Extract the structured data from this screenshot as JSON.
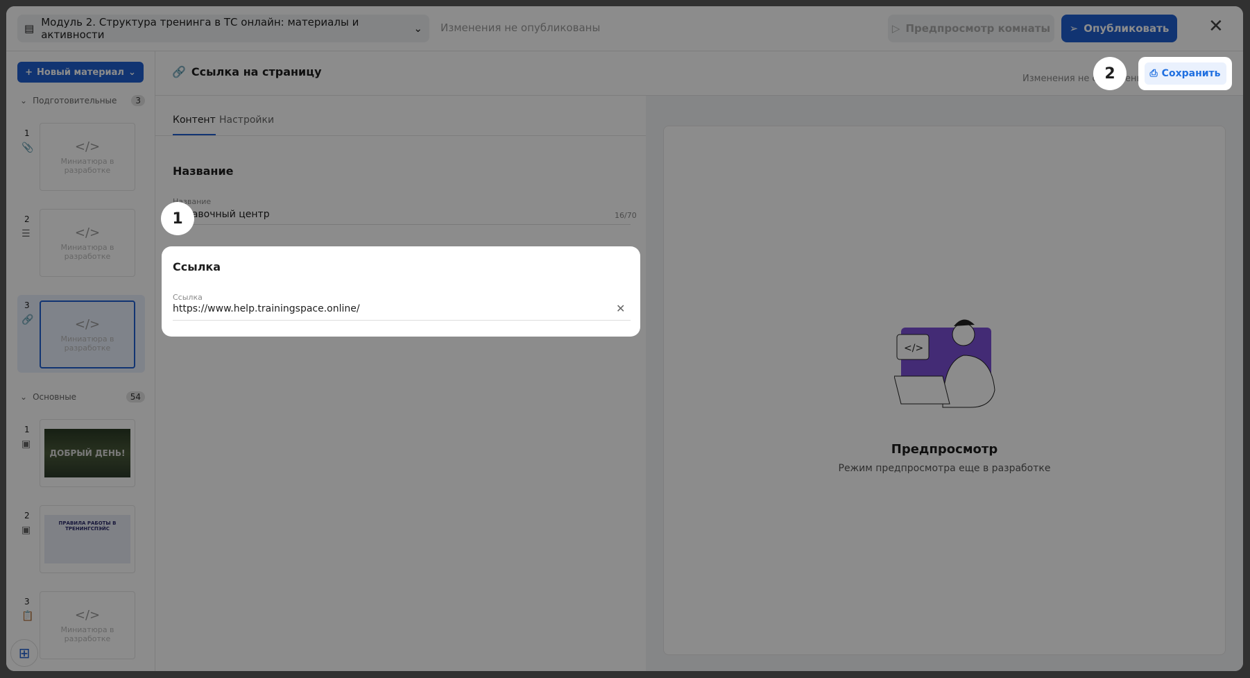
{
  "header": {
    "module_title": "Модуль 2. Структура тренинга в ТС онлайн: материалы и активности",
    "unpublished": "Изменения не опубликованы",
    "preview_room": "Предпросмотр комнаты",
    "publish": "Опубликовать"
  },
  "sidebar": {
    "new_material": "Новый материал",
    "sections": [
      {
        "title": "Подготовительные",
        "count": "3",
        "items": [
          {
            "num": "1",
            "icon": "paperclip-icon",
            "thumb": "Миниатюра в разработке"
          },
          {
            "num": "2",
            "icon": "checklist-icon",
            "thumb": "Миниатюра в разработке"
          },
          {
            "num": "3",
            "icon": "link-icon",
            "thumb": "Миниатюра в разработке"
          }
        ]
      },
      {
        "title": "Основные",
        "count": "54",
        "items": [
          {
            "num": "1",
            "icon": "presentation-icon",
            "thumb": "ДОБРЫЙ ДЕНЬ!"
          },
          {
            "num": "2",
            "icon": "presentation-icon",
            "thumb": "ПРАВИЛА РАБОТЫ В ТРЕНИНГСПЭЙС"
          },
          {
            "num": "3",
            "icon": "clipboard-icon",
            "thumb": "Миниатюра в разработке"
          }
        ]
      }
    ]
  },
  "editor": {
    "title": "Ссылка на страницу",
    "status": "Изменения не сохранены",
    "save": "Сохранить",
    "tabs": [
      "Контент",
      "Настройки"
    ],
    "name_section": "Название",
    "name_label": "Название",
    "name_value": "Справочный центр",
    "name_count": "16/70",
    "link_section": "Ссылка",
    "link_label": "Ссылка",
    "link_value": "https://www.help.trainingspace.online/"
  },
  "preview": {
    "title": "Предпросмотр",
    "subtitle": "Режим предпросмотра еще в разработке"
  },
  "steps": [
    "1",
    "2"
  ]
}
